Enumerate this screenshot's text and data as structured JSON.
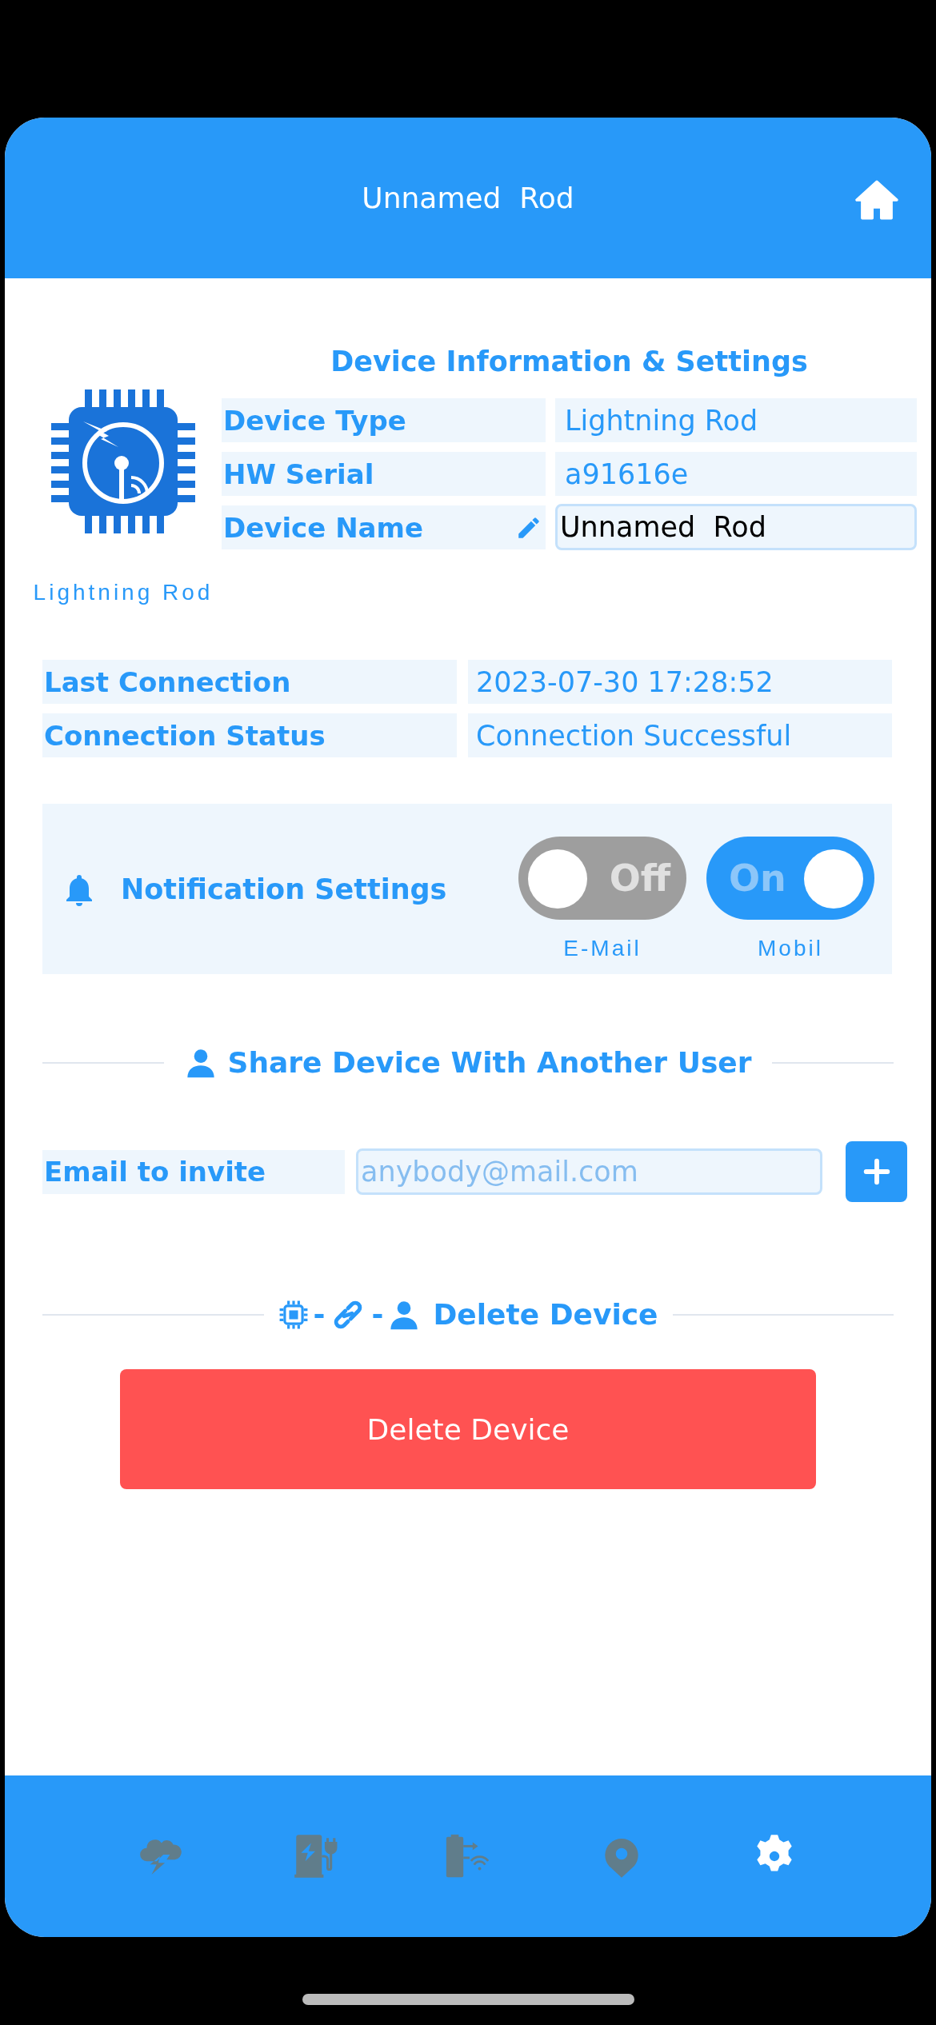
{
  "header": {
    "title": "Unnamed  Rod"
  },
  "logo": {
    "caption": "Lightning Rod"
  },
  "device_info": {
    "title": "Device Information & Settings",
    "rows": [
      {
        "label": "Device Type",
        "value": "Lightning Rod",
        "kind": "text"
      },
      {
        "label": "HW Serial",
        "value": "a91616e",
        "kind": "text"
      },
      {
        "label": "Device Name",
        "value": "Unnamed  Rod",
        "kind": "editable"
      }
    ]
  },
  "connection": {
    "rows": [
      {
        "label": "Last Connection",
        "value": "2023-07-30 17:28:52"
      },
      {
        "label": "Connection Status",
        "value": "Connection Successful"
      }
    ]
  },
  "notifications": {
    "title": "Notification Settings",
    "toggles": [
      {
        "name": "E-Mail",
        "on": false,
        "text": "Off"
      },
      {
        "name": "Mobil",
        "on": true,
        "text": "On"
      }
    ]
  },
  "share": {
    "title": "Share Device With Another User",
    "label": "Email to invite",
    "placeholder": "anybody@mail.com"
  },
  "delete": {
    "separator": "-",
    "title": "Delete Device",
    "button": "Delete Device"
  },
  "nav": [
    {
      "kind": "storm",
      "selected": false
    },
    {
      "kind": "charger",
      "selected": false
    },
    {
      "kind": "battery",
      "selected": false
    },
    {
      "kind": "location",
      "selected": false
    },
    {
      "kind": "settings",
      "selected": true
    }
  ]
}
